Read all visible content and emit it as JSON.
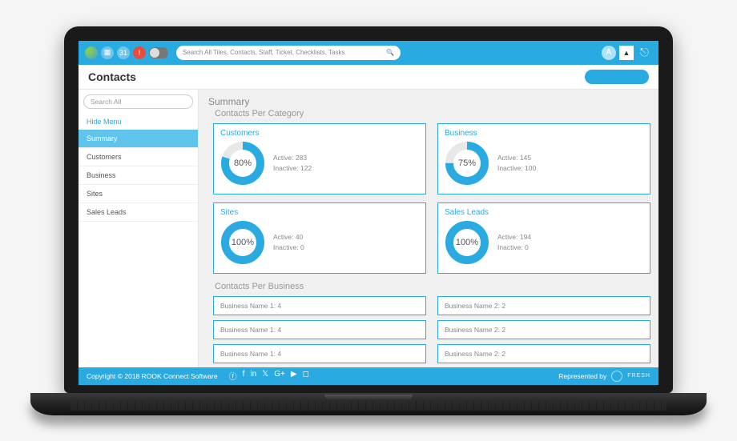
{
  "header": {
    "search_placeholder": "Search All Tiles, Contacts, Staff, Ticket, Checklists, Tasks",
    "avatar_letter": "A"
  },
  "page": {
    "title": "Contacts"
  },
  "sidebar": {
    "search_placeholder": "Search All",
    "hide_label": "Hide Menu",
    "items": [
      {
        "label": "Summary",
        "active": true
      },
      {
        "label": "Customers",
        "active": false
      },
      {
        "label": "Business",
        "active": false
      },
      {
        "label": "Sites",
        "active": false
      },
      {
        "label": "Sales Leads",
        "active": false
      }
    ]
  },
  "summary": {
    "title": "Summary",
    "section1_title": "Contacts Per Category",
    "section2_title": "Contacts Per Business",
    "active_label": "Active",
    "inactive_label": "Inactive"
  },
  "chart_data": [
    {
      "type": "pie",
      "title": "Customers",
      "values": [
        80,
        20
      ],
      "display_pct": "80%",
      "active": 283,
      "inactive": 122
    },
    {
      "type": "pie",
      "title": "Business",
      "values": [
        75,
        25
      ],
      "display_pct": "75%",
      "active": 145,
      "inactive": 100
    },
    {
      "type": "pie",
      "title": "Sites",
      "values": [
        100,
        0
      ],
      "display_pct": "100%",
      "active": 40,
      "inactive": 0
    },
    {
      "type": "pie",
      "title": "Sales Leads",
      "values": [
        100,
        0
      ],
      "display_pct": "100%",
      "active": 194,
      "inactive": 0
    }
  ],
  "per_business": {
    "col1": [
      {
        "text": "Business Name 1: 4"
      },
      {
        "text": "Business Name 1: 4"
      },
      {
        "text": "Business Name 1: 4"
      }
    ],
    "col2": [
      {
        "text": "Business Name 2: 2"
      },
      {
        "text": "Business Name 2: 2"
      },
      {
        "text": "Business Name 2: 2"
      }
    ]
  },
  "footer": {
    "copyright": "Copyright © 2018 ROOK Connect Software",
    "represented": "Represented by",
    "partner": "FRESH"
  }
}
